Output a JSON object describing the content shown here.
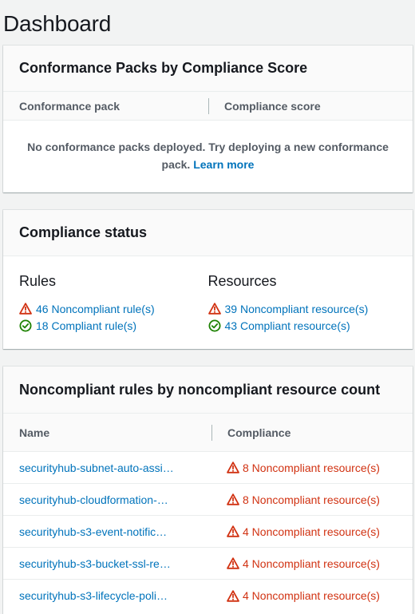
{
  "page": {
    "title": "Dashboard"
  },
  "conformance": {
    "title": "Conformance Packs by Compliance Score",
    "col_pack": "Conformance pack",
    "col_score": "Compliance score",
    "empty_text": "No conformance packs deployed. Try deploying a new conformance pack.",
    "learn_more": "Learn more"
  },
  "compliance_status": {
    "title": "Compliance status",
    "rules_heading": "Rules",
    "resources_heading": "Resources",
    "rules_noncompliant": "46 Noncompliant rule(s)",
    "rules_compliant": "18 Compliant rule(s)",
    "resources_noncompliant": "39 Noncompliant resource(s)",
    "resources_compliant": "43 Compliant resource(s)"
  },
  "noncompliant_rules": {
    "title": "Noncompliant rules by noncompliant resource count",
    "col_name": "Name",
    "col_compliance": "Compliance",
    "rows": [
      {
        "name": "securityhub-subnet-auto-assi…",
        "compliance": "8 Noncompliant resource(s)"
      },
      {
        "name": "securityhub-cloudformation-…",
        "compliance": "8 Noncompliant resource(s)"
      },
      {
        "name": "securityhub-s3-event-notific…",
        "compliance": "4 Noncompliant resource(s)"
      },
      {
        "name": "securityhub-s3-bucket-ssl-re…",
        "compliance": "4 Noncompliant resource(s)"
      },
      {
        "name": "securityhub-s3-lifecycle-poli…",
        "compliance": "4 Noncompliant resource(s)"
      }
    ]
  },
  "colors": {
    "link": "#0073bb",
    "warning": "#d13212",
    "success": "#1d8102",
    "header_bg": "#fafafa"
  },
  "icons": {
    "warning": "warning-triangle-icon",
    "success": "check-circle-icon"
  }
}
